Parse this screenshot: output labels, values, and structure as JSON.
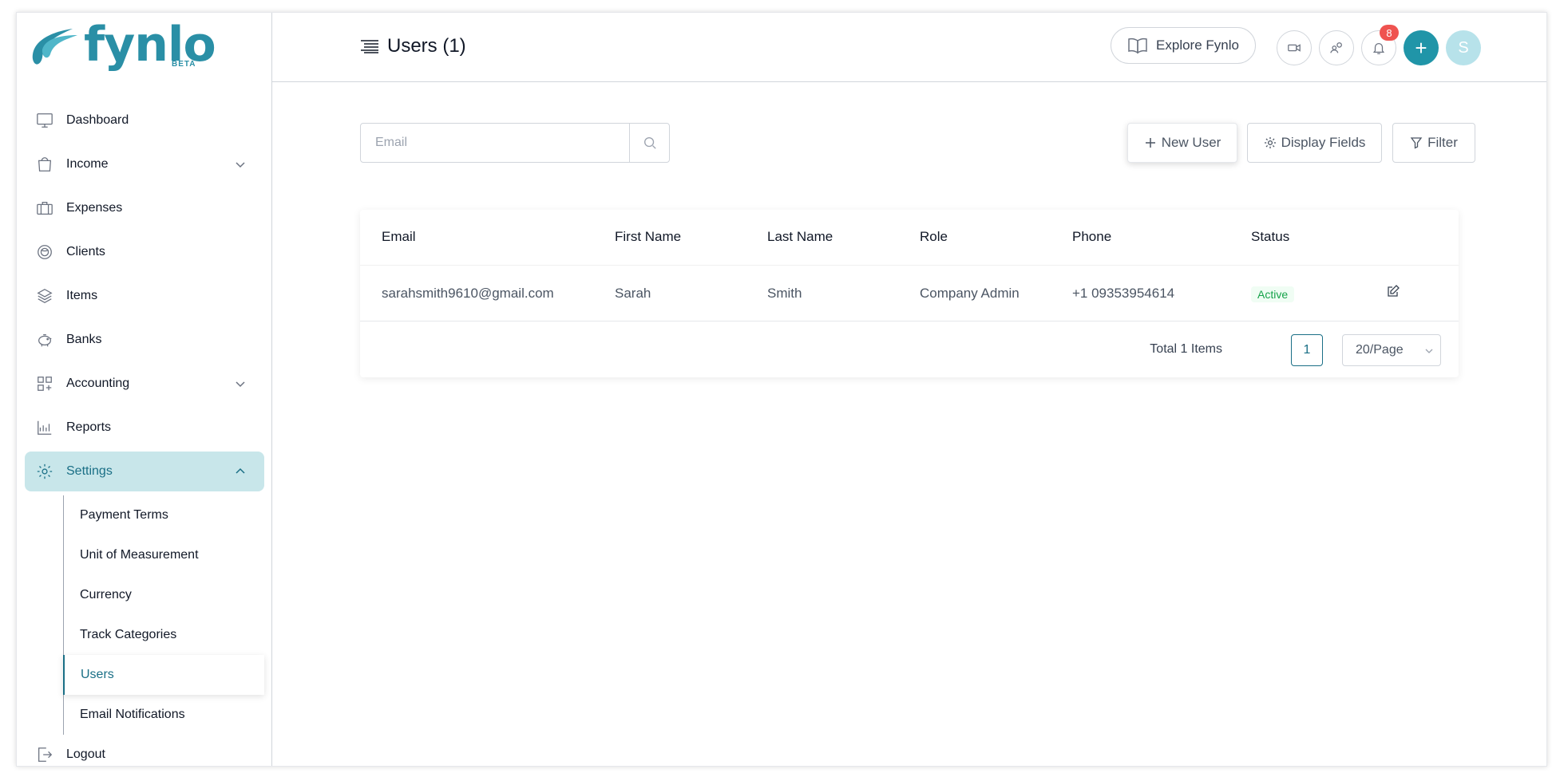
{
  "brand": {
    "name": "fynlo",
    "beta": "BETA"
  },
  "sidebar": {
    "items": [
      {
        "label": "Dashboard",
        "icon": "monitor-icon"
      },
      {
        "label": "Income",
        "icon": "shopping-bag-icon",
        "expandable": true
      },
      {
        "label": "Expenses",
        "icon": "briefcase-icon"
      },
      {
        "label": "Clients",
        "icon": "globe-icon"
      },
      {
        "label": "Items",
        "icon": "layers-icon"
      },
      {
        "label": "Banks",
        "icon": "piggy-bank-icon"
      },
      {
        "label": "Accounting",
        "icon": "grid-plus-icon",
        "expandable": true
      },
      {
        "label": "Reports",
        "icon": "chart-icon"
      },
      {
        "label": "Settings",
        "icon": "gear-icon",
        "expandable": true,
        "active": true
      }
    ],
    "settings_sub": [
      {
        "label": "Payment Terms"
      },
      {
        "label": "Unit of Measurement"
      },
      {
        "label": "Currency"
      },
      {
        "label": "Track Categories"
      },
      {
        "label": "Users",
        "active": true
      },
      {
        "label": "Email Notifications"
      }
    ],
    "logout": "Logout"
  },
  "header": {
    "title": "Users (1)",
    "explore_label": "Explore Fynlo",
    "notification_count": "8",
    "plus": "+",
    "avatar_initial": "S"
  },
  "toolbar": {
    "search_placeholder": "Email",
    "new_user": "New User",
    "display_fields": "Display Fields",
    "filter": "Filter"
  },
  "table": {
    "columns": [
      "Email",
      "First Name",
      "Last Name",
      "Role",
      "Phone",
      "Status"
    ],
    "rows": [
      {
        "email": "sarahsmith9610@gmail.com",
        "first_name": "Sarah",
        "last_name": "Smith",
        "role": "Company Admin",
        "phone": "+1 09353954614",
        "status": "Active"
      }
    ],
    "total": "Total 1 Items",
    "current_page": "1",
    "page_size": "20/Page"
  },
  "colors": {
    "accent": "#1a6f86",
    "brand": "#2a8fa6",
    "active_bg": "#c8e6ea",
    "success": "#16a34a",
    "badge": "#ef5350"
  }
}
